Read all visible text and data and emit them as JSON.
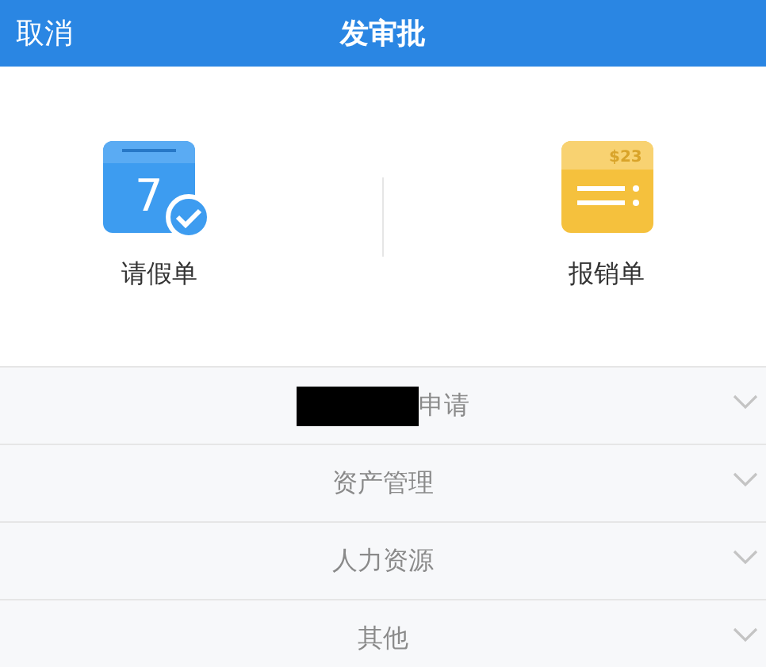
{
  "header": {
    "cancel": "取消",
    "title": "发审批"
  },
  "shortcuts": [
    {
      "kind": "calendar",
      "icon_text": "7",
      "label": "请假单"
    },
    {
      "kind": "expense",
      "icon_text": "$23",
      "label": "报销单"
    }
  ],
  "sections": [
    {
      "label": "申请",
      "redacted": true,
      "expanded": false
    },
    {
      "label": "资产管理",
      "redacted": false,
      "expanded": false
    },
    {
      "label": "人力资源",
      "redacted": false,
      "expanded": false
    },
    {
      "label": "其他",
      "redacted": false,
      "expanded": false
    }
  ]
}
